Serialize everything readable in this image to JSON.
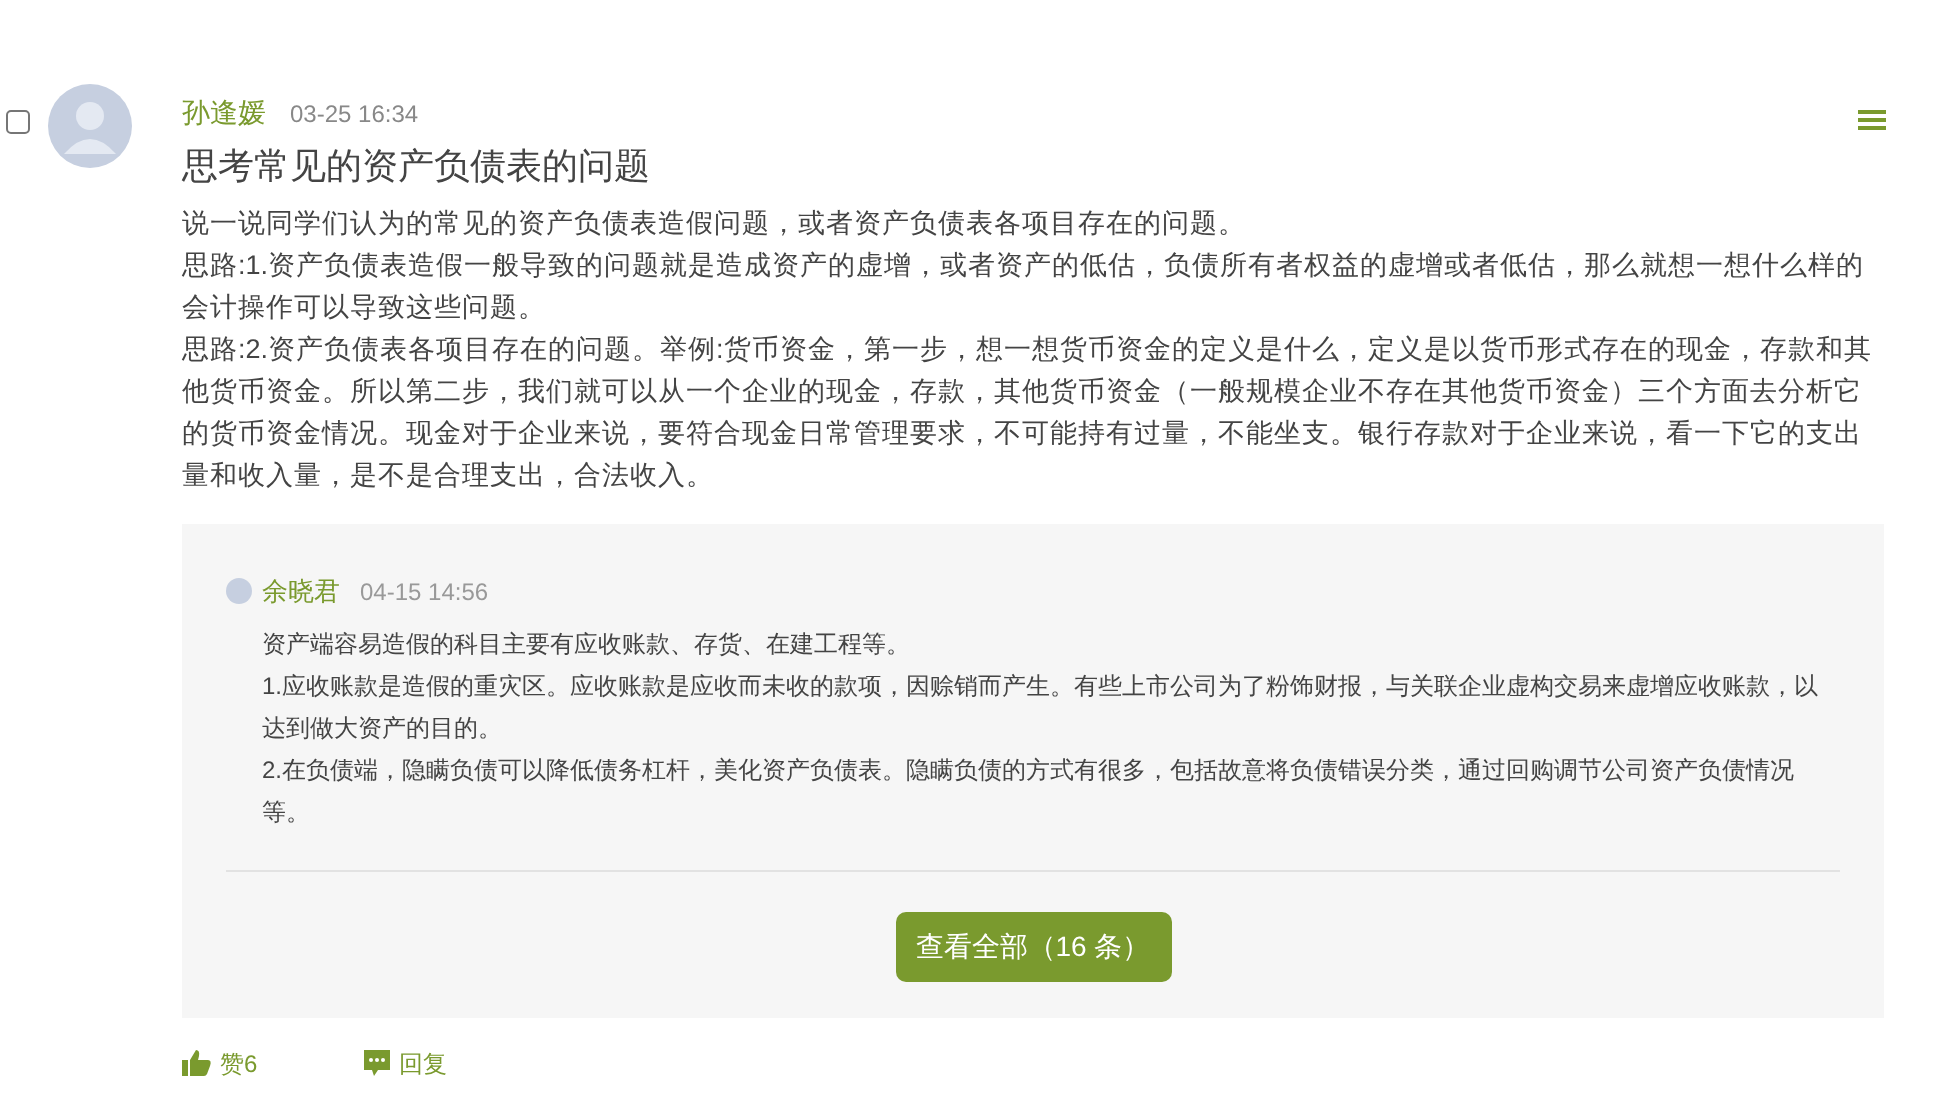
{
  "post": {
    "selected": false,
    "author": "孙逢媛",
    "time": "03-25 16:34",
    "title": "思考常见的资产负债表的问题",
    "paragraphs": [
      "说一说同学们认为的常见的资产负债表造假问题，或者资产负债表各项目存在的问题。",
      "思路:1.资产负债表造假一般导致的问题就是造成资产的虚增，或者资产的低估，负债所有者权益的虚增或者低估，那么就想一想什么样的会计操作可以导致这些问题。",
      "思路:2.资产负债表各项目存在的问题。举例:货币资金，第一步，想一想货币资金的定义是什么，定义是以货币形式存在的现金，存款和其他货币资金。所以第二步，我们就可以从一个企业的现金，存款，其他货币资金（一般规模企业不存在其他货币资金）三个方面去分析它的货币资金情况。现金对于企业来说，要符合现金日常管理要求，不可能持有过量，不能坐支。银行存款对于企业来说，看一下它的支出量和收入量，是不是合理支出，合法收入。"
    ]
  },
  "replies": [
    {
      "author": "余晓君",
      "time": "04-15 14:56",
      "lines": [
        "资产端容易造假的科目主要有应收账款、存货、在建工程等。",
        "1.应收账款是造假的重灾区。应收账款是应收而未收的款项，因赊销而产生。有些上市公司为了粉饰财报，与关联企业虚构交易来虚增应收账款，以达到做大资产的目的。",
        "2.在负债端，隐瞒负债可以降低债务杠杆，美化资产负债表。隐瞒负债的方式有很多，包括故意将负债错误分类，通过回购调节公司资产负债情况等。"
      ]
    }
  ],
  "view_all_button": "查看全部（16 条）",
  "actions": [
    {
      "kind": "like",
      "label": "赞6"
    },
    {
      "kind": "reply",
      "label": "回复"
    }
  ]
}
